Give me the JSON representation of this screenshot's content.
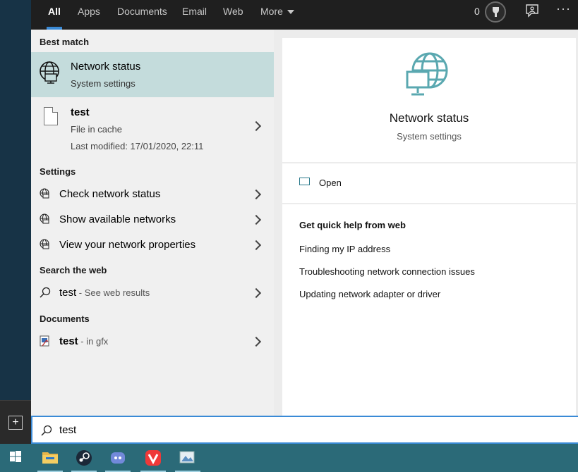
{
  "tabs": [
    {
      "label": "All"
    },
    {
      "label": "Apps"
    },
    {
      "label": "Documents"
    },
    {
      "label": "Email"
    },
    {
      "label": "Web"
    },
    {
      "label": "More"
    }
  ],
  "header": {
    "points": "0",
    "more_dots": "···"
  },
  "best_match": {
    "section": "Best match",
    "title": "Network status",
    "subtitle": "System settings"
  },
  "file_result": {
    "name": "test",
    "type": "File in cache",
    "modified": "Last modified: 17/01/2020, 22:11"
  },
  "settings": {
    "section": "Settings",
    "items": [
      {
        "label": "Check network status"
      },
      {
        "label": "Show available networks"
      },
      {
        "label": "View your network properties"
      }
    ]
  },
  "web": {
    "section": "Search the web",
    "query": "test",
    "hint": " - See web results"
  },
  "documents": {
    "section": "Documents",
    "name": "test",
    "hint": " - in gfx"
  },
  "preview": {
    "title": "Network status",
    "subtitle": "System settings",
    "open_label": "Open",
    "help_heading": "Get quick help from web",
    "links": [
      {
        "label": "Finding my IP address"
      },
      {
        "label": "Troubleshooting network connection issues"
      },
      {
        "label": "Updating network adapter or driver"
      }
    ]
  },
  "search": {
    "value": "test"
  },
  "taskbar": {
    "apps": [
      "start",
      "file-explorer",
      "steam",
      "discord",
      "vivaldi",
      "photos"
    ]
  },
  "colors": {
    "accent": "#3a8ad6",
    "selection": "#c4dcdc",
    "icon_teal": "#5aa8b0",
    "taskbar": "#2b6a78"
  }
}
